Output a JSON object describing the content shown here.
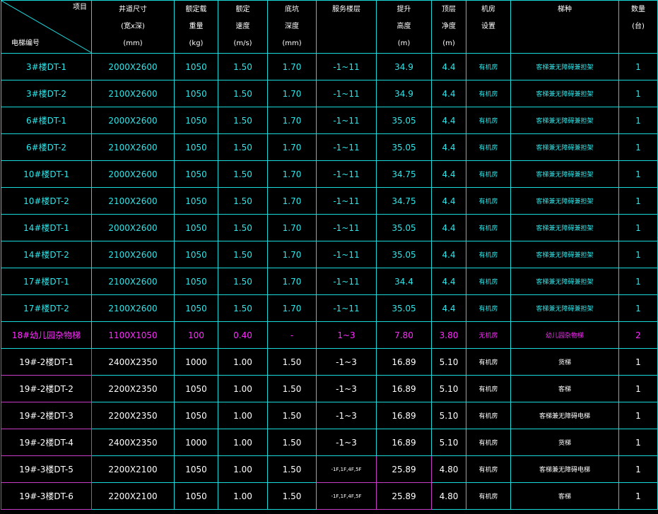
{
  "header": {
    "corner_top": "项目",
    "corner_bottom": "电梯编号",
    "columns": [
      [
        "井道尺寸",
        "(宽x深)",
        "(mm)"
      ],
      [
        "额定载",
        "重量",
        "(kg)"
      ],
      [
        "额定",
        "速度",
        "(m/s)"
      ],
      [
        "底坑",
        "深度",
        "(mm)"
      ],
      [
        "服务楼层",
        "",
        ""
      ],
      [
        "提升",
        "高度",
        "(m)"
      ],
      [
        "顶层",
        "净度",
        "(m)"
      ],
      [
        "机房",
        "设置",
        ""
      ],
      [
        "梯种",
        "",
        ""
      ],
      [
        "数量",
        "(台)",
        ""
      ]
    ]
  },
  "rows": [
    {
      "id": "3#楼DT-1",
      "size": "2000X2600",
      "load": "1050",
      "speed": "1.50",
      "pit": "1.70",
      "floors": "-1~11",
      "rise": "34.9",
      "top": "4.4",
      "room": "有机房",
      "type": "客梯兼无障碍兼担架",
      "qty": "1"
    },
    {
      "id": "3#楼DT-2",
      "size": "2100X2600",
      "load": "1050",
      "speed": "1.50",
      "pit": "1.70",
      "floors": "-1~11",
      "rise": "34.9",
      "top": "4.4",
      "room": "有机房",
      "type": "客梯兼无障碍兼担架",
      "qty": "1"
    },
    {
      "id": "6#楼DT-1",
      "size": "2000X2600",
      "load": "1050",
      "speed": "1.50",
      "pit": "1.70",
      "floors": "-1~11",
      "rise": "35.05",
      "top": "4.4",
      "room": "有机房",
      "type": "客梯兼无障碍兼担架",
      "qty": "1"
    },
    {
      "id": "6#楼DT-2",
      "size": "2100X2600",
      "load": "1050",
      "speed": "1.50",
      "pit": "1.70",
      "floors": "-1~11",
      "rise": "35.05",
      "top": "4.4",
      "room": "有机房",
      "type": "客梯兼无障碍兼担架",
      "qty": "1"
    },
    {
      "id": "10#楼DT-1",
      "size": "2000X2600",
      "load": "1050",
      "speed": "1.50",
      "pit": "1.70",
      "floors": "-1~11",
      "rise": "34.75",
      "top": "4.4",
      "room": "有机房",
      "type": "客梯兼无障碍兼担架",
      "qty": "1"
    },
    {
      "id": "10#楼DT-2",
      "size": "2100X2600",
      "load": "1050",
      "speed": "1.50",
      "pit": "1.70",
      "floors": "-1~11",
      "rise": "34.75",
      "top": "4.4",
      "room": "有机房",
      "type": "客梯兼无障碍兼担架",
      "qty": "1"
    },
    {
      "id": "14#楼DT-1",
      "size": "2000X2600",
      "load": "1050",
      "speed": "1.50",
      "pit": "1.70",
      "floors": "-1~11",
      "rise": "35.05",
      "top": "4.4",
      "room": "有机房",
      "type": "客梯兼无障碍兼担架",
      "qty": "1"
    },
    {
      "id": "14#楼DT-2",
      "size": "2100X2600",
      "load": "1050",
      "speed": "1.50",
      "pit": "1.70",
      "floors": "-1~11",
      "rise": "35.05",
      "top": "4.4",
      "room": "有机房",
      "type": "客梯兼无障碍兼担架",
      "qty": "1"
    },
    {
      "id": "17#楼DT-1",
      "size": "2100X2600",
      "load": "1050",
      "speed": "1.50",
      "pit": "1.70",
      "floors": "-1~11",
      "rise": "34.4",
      "top": "4.4",
      "room": "有机房",
      "type": "客梯兼无障碍兼担架",
      "qty": "1"
    },
    {
      "id": "17#楼DT-2",
      "size": "2100X2600",
      "load": "1050",
      "speed": "1.50",
      "pit": "1.70",
      "floors": "-1~11",
      "rise": "35.05",
      "top": "4.4",
      "room": "有机房",
      "type": "客梯兼无障碍兼担架",
      "qty": "1"
    },
    {
      "id": "18#幼儿园杂物梯",
      "size": "1100X1050",
      "load": "100",
      "speed": "0.40",
      "pit": "-",
      "floors": "1~3",
      "rise": "7.80",
      "top": "3.80",
      "room": "无机房",
      "type": "幼儿园杂物梯",
      "qty": "2"
    },
    {
      "id": "19#-2楼DT-1",
      "size": "2400X2350",
      "load": "1000",
      "speed": "1.00",
      "pit": "1.50",
      "floors": "-1~3",
      "rise": "16.89",
      "top": "5.10",
      "room": "有机房",
      "type": "货梯",
      "qty": "1"
    },
    {
      "id": "19#-2楼DT-2",
      "size": "2200X2350",
      "load": "1050",
      "speed": "1.00",
      "pit": "1.50",
      "floors": "-1~3",
      "rise": "16.89",
      "top": "5.10",
      "room": "有机房",
      "type": "客梯",
      "qty": "1"
    },
    {
      "id": "19#-2楼DT-3",
      "size": "2200X2350",
      "load": "1050",
      "speed": "1.00",
      "pit": "1.50",
      "floors": "-1~3",
      "rise": "16.89",
      "top": "5.10",
      "room": "有机房",
      "type": "客梯兼无障碍电梯",
      "qty": "1"
    },
    {
      "id": "19#-2楼DT-4",
      "size": "2400X2350",
      "load": "1000",
      "speed": "1.00",
      "pit": "1.50",
      "floors": "-1~3",
      "rise": "16.89",
      "top": "5.10",
      "room": "有机房",
      "type": "货梯",
      "qty": "1"
    },
    {
      "id": "19#-3楼DT-5",
      "size": "2200X2100",
      "load": "1050",
      "speed": "1.00",
      "pit": "1.50",
      "floors": "-1F,1F,4F,5F",
      "rise": "25.89",
      "top": "4.80",
      "room": "有机房",
      "type": "客梯兼无障碍电梯",
      "qty": "1"
    },
    {
      "id": "19#-3楼DT-6",
      "size": "2200X2100",
      "load": "1050",
      "speed": "1.00",
      "pit": "1.50",
      "floors": "-1F,1F,4F,5F",
      "rise": "25.89",
      "top": "4.80",
      "room": "有机房",
      "type": "客梯",
      "qty": "1"
    }
  ],
  "colors": {
    "grid": "#19d8dc",
    "cyan_text": "#2fe6ea",
    "white_text": "#ffffff",
    "magenta": "#ff2bff",
    "magenta_border": "#c63cc6",
    "background": "#000000"
  }
}
